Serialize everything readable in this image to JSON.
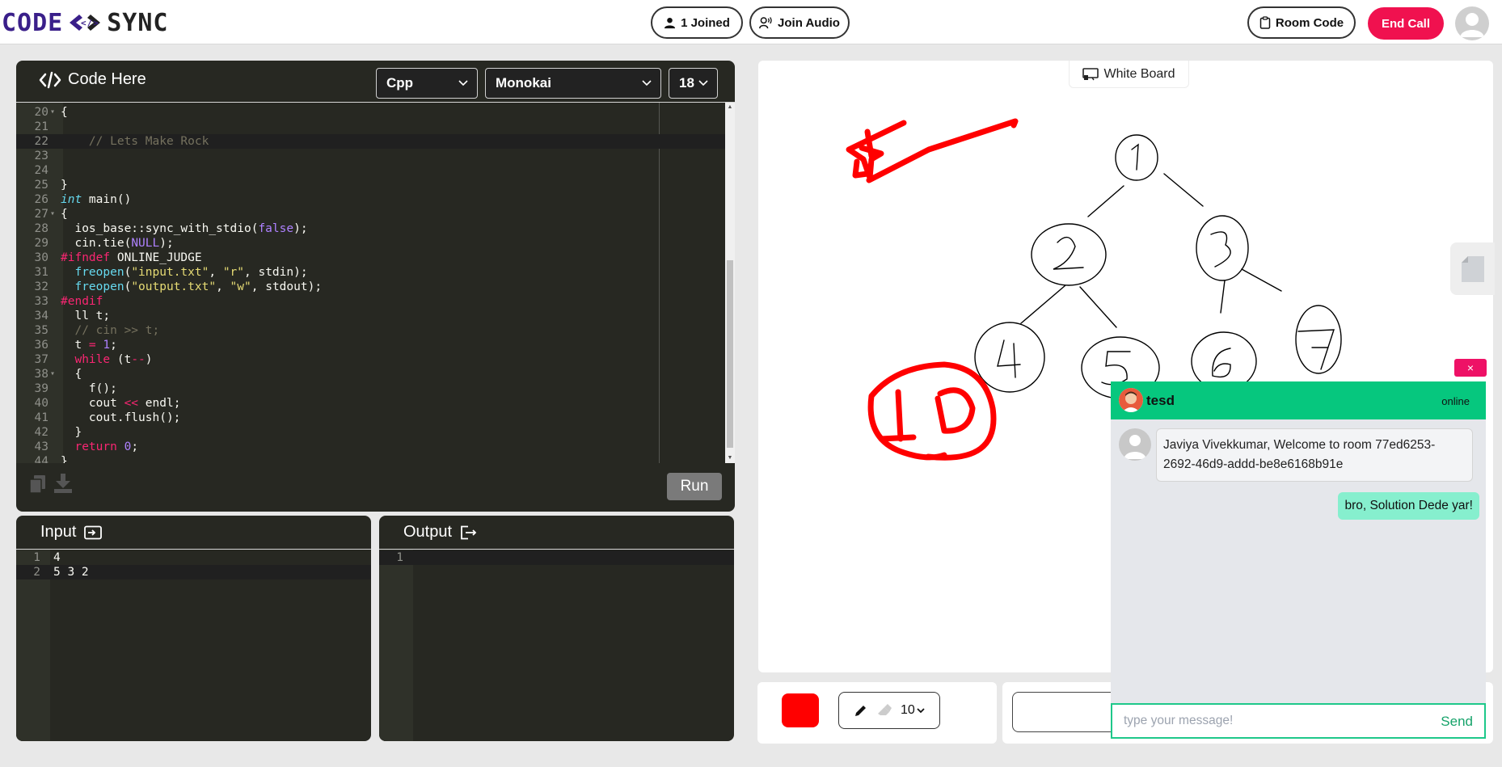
{
  "header": {
    "logo_left": "CODE",
    "logo_right": "SYNC",
    "joined_label": "1 Joined",
    "join_audio_label": "Join Audio",
    "room_code_label": "Room Code",
    "end_call_label": "End Call"
  },
  "editor": {
    "title": "Code Here",
    "language": "Cpp",
    "theme": "Monokai",
    "font_size": "18",
    "run_label": "Run",
    "lines": [
      {
        "n": "20",
        "fold": true,
        "html": "{"
      },
      {
        "n": "21",
        "fold": false,
        "html": ""
      },
      {
        "n": "22",
        "fold": false,
        "active": true,
        "html": "    <span class=\"cm\">// Lets Make Rock</span>"
      },
      {
        "n": "23",
        "fold": false,
        "html": ""
      },
      {
        "n": "24",
        "fold": false,
        "html": ""
      },
      {
        "n": "25",
        "fold": false,
        "html": "}"
      },
      {
        "n": "26",
        "fold": false,
        "html": "<span class=\"k\">int</span> main()"
      },
      {
        "n": "27",
        "fold": true,
        "html": "{"
      },
      {
        "n": "28",
        "fold": false,
        "html": "  ios_base::sync_with_stdio(<span class=\"num\">false</span>);"
      },
      {
        "n": "29",
        "fold": false,
        "html": "  cin.tie(<span class=\"num\">NULL</span>);"
      },
      {
        "n": "30",
        "fold": false,
        "html": "<span class=\"kw\">#ifndef</span> ONLINE_JUDGE"
      },
      {
        "n": "31",
        "fold": false,
        "html": "  <span class=\"fn\">freopen</span>(<span class=\"str\">\"input.txt\"</span>, <span class=\"str\">\"r\"</span>, stdin);"
      },
      {
        "n": "32",
        "fold": false,
        "html": "  <span class=\"fn\">freopen</span>(<span class=\"str\">\"output.txt\"</span>, <span class=\"str\">\"w\"</span>, stdout);"
      },
      {
        "n": "33",
        "fold": false,
        "html": "<span class=\"kw\">#endif</span>"
      },
      {
        "n": "34",
        "fold": false,
        "html": "  ll t;"
      },
      {
        "n": "35",
        "fold": false,
        "html": "  <span class=\"cm\">// cin &gt;&gt; t;</span>"
      },
      {
        "n": "36",
        "fold": false,
        "html": "  t <span class=\"kw\">=</span> <span class=\"num\">1</span>;"
      },
      {
        "n": "37",
        "fold": false,
        "html": "  <span class=\"kw\">while</span> (t<span class=\"kw\">--</span>)"
      },
      {
        "n": "38",
        "fold": true,
        "html": "  {"
      },
      {
        "n": "39",
        "fold": false,
        "html": "    f();"
      },
      {
        "n": "40",
        "fold": false,
        "html": "    cout <span class=\"kw\">&lt;&lt;</span> endl;"
      },
      {
        "n": "41",
        "fold": false,
        "html": "    cout.flush();"
      },
      {
        "n": "42",
        "fold": false,
        "html": "  }"
      },
      {
        "n": "43",
        "fold": false,
        "html": "  <span class=\"kw\">return</span> <span class=\"num\">0</span>;"
      },
      {
        "n": "44",
        "fold": false,
        "html": "}"
      }
    ]
  },
  "input_panel": {
    "title": "Input",
    "lines": [
      {
        "n": "1",
        "text": "4"
      },
      {
        "n": "2",
        "text": "5 3 2"
      }
    ]
  },
  "output_panel": {
    "title": "Output",
    "lines": [
      {
        "n": "1",
        "text": ""
      }
    ]
  },
  "whiteboard": {
    "tab_label": "White Board",
    "stroke_color": "#ff0000",
    "brush_size": "10"
  },
  "chat": {
    "close_label": "×",
    "user_name": "tesd",
    "status": "online",
    "incoming": "Javiya Vivekkumar, Welcome to room 77ed6253-2692-46d9-addd-be8e6168b91e",
    "outgoing": "bro, Solution Dede yar!",
    "input_placeholder": "type your message!",
    "send_label": "Send"
  }
}
